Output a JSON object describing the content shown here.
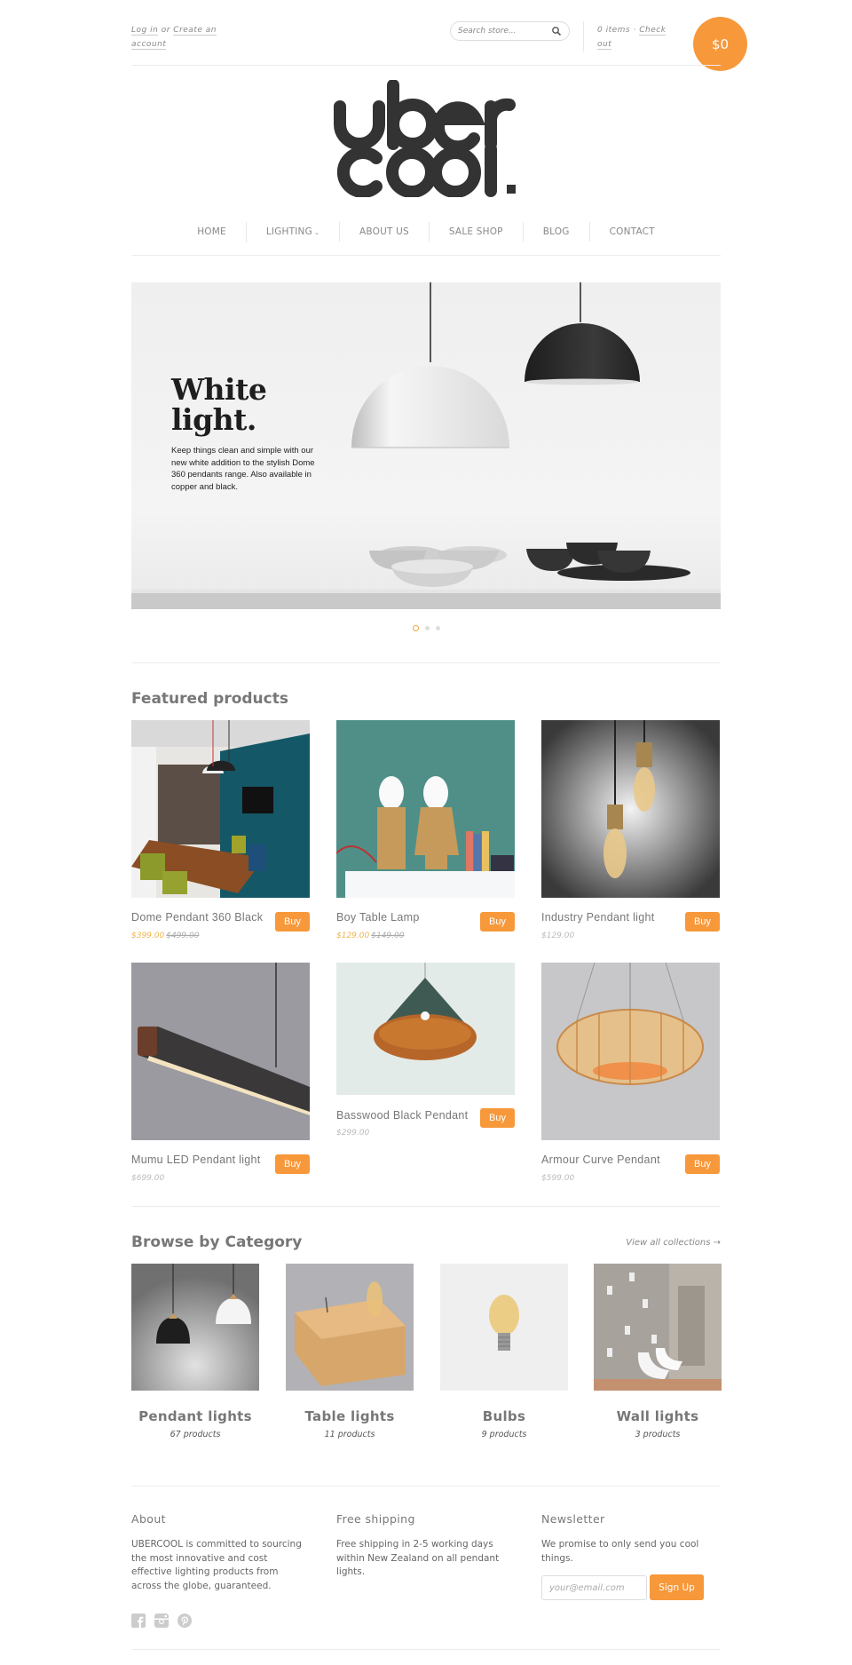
{
  "header": {
    "login_label": "Log in",
    "or_label": "or",
    "create_account_label": "Create an account",
    "search_placeholder": "Search store...",
    "cart_items": "0 items",
    "cart_separator": "·",
    "checkout_label": "Check out",
    "cart_total": "$0",
    "logo_alt": "ubercool."
  },
  "nav": {
    "items": [
      {
        "label": "HOME"
      },
      {
        "label": "LIGHTING",
        "has_dropdown": true
      },
      {
        "label": "ABOUT US"
      },
      {
        "label": "SALE SHOP"
      },
      {
        "label": "BLOG"
      },
      {
        "label": "CONTACT"
      }
    ],
    "caret": "⌄"
  },
  "hero": {
    "title_line1": "White",
    "title_line2": "light.",
    "text": "Keep things clean and simple with our new white addition to the stylish Dome 360 pendants range. Also available in copper and black.",
    "slides": 3,
    "active_slide": 1
  },
  "featured": {
    "title": "Featured products",
    "buy_label": "Buy",
    "products": [
      {
        "name": "Dome Pendant 360 Black",
        "price": "$399.00",
        "compare_price": "$499.00",
        "on_sale": true
      },
      {
        "name": "Boy Table Lamp",
        "price": "$129.00",
        "compare_price": "$149.00",
        "on_sale": true
      },
      {
        "name": "Industry Pendant light",
        "price": "$129.00",
        "compare_price": null,
        "on_sale": false
      },
      {
        "name": "Mumu LED Pendant light",
        "price": "$699.00",
        "compare_price": null,
        "on_sale": false
      },
      {
        "name": "Basswood Black Pendant",
        "price": "$299.00",
        "compare_price": null,
        "on_sale": false
      },
      {
        "name": "Armour Curve Pendant",
        "price": "$599.00",
        "compare_price": null,
        "on_sale": false
      }
    ]
  },
  "categories": {
    "title": "Browse by Category",
    "view_all_label": "View all collections →",
    "items": [
      {
        "title": "Pendant lights",
        "count": "67 products"
      },
      {
        "title": "Table lights",
        "count": "11 products"
      },
      {
        "title": "Bulbs",
        "count": "9 products"
      },
      {
        "title": "Wall lights",
        "count": "3 products"
      }
    ]
  },
  "footer": {
    "about": {
      "title": "About",
      "text": "UBERCOOL is committed to sourcing the most innovative and cost effective lighting products from across the globe, guaranteed."
    },
    "shipping": {
      "title": "Free shipping",
      "text": "Free shipping in 2-5 working days within New Zealand on all pendant lights."
    },
    "newsletter": {
      "title": "Newsletter",
      "text": "We promise to only send you cool things.",
      "email_placeholder": "your@email.com",
      "signup_label": "Sign Up"
    },
    "social": [
      "facebook-icon",
      "instagram-icon",
      "pinterest-icon"
    ]
  },
  "colors": {
    "accent": "#f7983a",
    "sale_price": "#f0b44a",
    "text": "#777777"
  }
}
